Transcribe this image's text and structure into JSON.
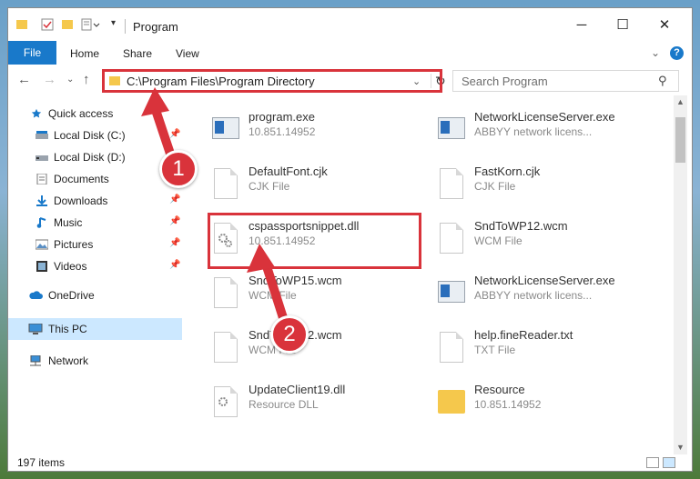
{
  "window": {
    "title": "Program",
    "controls": {
      "minimize": "─",
      "maximize": "☐",
      "close": "✕"
    }
  },
  "ribbon": {
    "tabs": [
      "File",
      "Home",
      "Share",
      "View"
    ],
    "help": "?"
  },
  "navbar": {
    "address": "C:\\Program Files\\Program Directory",
    "search_placeholder": "Search Program"
  },
  "sidebar": {
    "items": [
      {
        "label": "Quick access",
        "icon": "star-icon",
        "pinned": false
      },
      {
        "label": "Local Disk (C:)",
        "icon": "drive-icon",
        "pinned": true
      },
      {
        "label": "Local Disk (D:)",
        "icon": "drive-icon",
        "pinned": true
      },
      {
        "label": "Documents",
        "icon": "documents-icon",
        "pinned": true
      },
      {
        "label": "Downloads",
        "icon": "download-icon",
        "pinned": true
      },
      {
        "label": "Music",
        "icon": "music-icon",
        "pinned": true
      },
      {
        "label": "Pictures",
        "icon": "pictures-icon",
        "pinned": true
      },
      {
        "label": "Videos",
        "icon": "videos-icon",
        "pinned": true
      },
      {
        "label": "OneDrive",
        "icon": "cloud-icon",
        "pinned": false
      },
      {
        "label": "This PC",
        "icon": "computer-icon",
        "pinned": false,
        "selected": true
      },
      {
        "label": "Network",
        "icon": "network-icon",
        "pinned": false
      }
    ]
  },
  "files": [
    {
      "name": "program.exe",
      "sub": "10.851.14952",
      "type": "exe"
    },
    {
      "name": "NetworkLicenseServer.exe",
      "sub": "ABBYY network licens...",
      "type": "exe"
    },
    {
      "name": "DefaultFont.cjk",
      "sub": "CJK File",
      "type": "page"
    },
    {
      "name": "FastKorn.cjk",
      "sub": "CJK File",
      "type": "page"
    },
    {
      "name": "cspassportsnippet.dll",
      "sub": "10.851.14952",
      "type": "dll"
    },
    {
      "name": "SndToWP12.wcm",
      "sub": "WCM File",
      "type": "page"
    },
    {
      "name": "SndToWP15.wcm",
      "sub": "WCM File",
      "type": "page"
    },
    {
      "name": "NetworkLicenseServer.exe",
      "sub": "ABBYY network licens...",
      "type": "exe"
    },
    {
      "name": "SndToWP12.wcm",
      "sub": "WCM File",
      "type": "page"
    },
    {
      "name": "help.fineReader.txt",
      "sub": "TXT File",
      "type": "page"
    },
    {
      "name": "UpdateClient19.dll",
      "sub": "Resource DLL",
      "type": "dll"
    },
    {
      "name": "Resource",
      "sub": "10.851.14952",
      "type": "folder"
    }
  ],
  "status": {
    "count": "197 items"
  },
  "annotations": {
    "step1": "1",
    "step2": "2",
    "color": "#d9333b"
  }
}
